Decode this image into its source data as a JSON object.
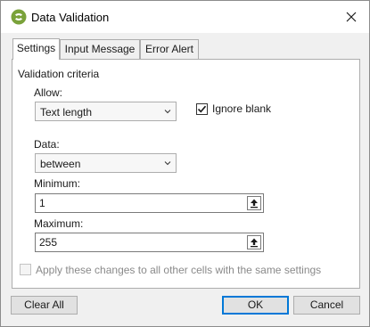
{
  "window": {
    "title": "Data Validation",
    "icon": "app-logo-icon",
    "close_icon": "close-icon"
  },
  "tabs": [
    {
      "label": "Settings",
      "active": true
    },
    {
      "label": "Input Message",
      "active": false
    },
    {
      "label": "Error Alert",
      "active": false
    }
  ],
  "settings": {
    "group_title": "Validation criteria",
    "allow_label": "Allow:",
    "allow_value": "Text length",
    "ignore_blank_label": "Ignore blank",
    "ignore_blank_checked": true,
    "data_label": "Data:",
    "data_value": "between",
    "minimum_label": "Minimum:",
    "minimum_value": "1",
    "maximum_label": "Maximum:",
    "maximum_value": "255",
    "apply_all_label": "Apply these changes to all other cells with the same settings",
    "apply_all_checked": false
  },
  "buttons": {
    "clear_all": "Clear All",
    "ok": "OK",
    "cancel": "Cancel"
  },
  "colors": {
    "accent": "#0078d7",
    "logo_green": "#7aa23a"
  }
}
